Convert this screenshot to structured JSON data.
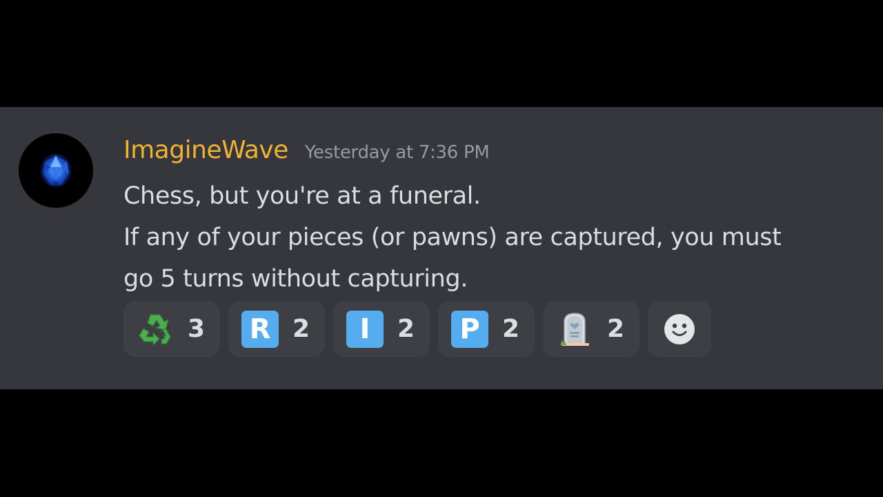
{
  "message": {
    "author": {
      "name": "ImagineWave",
      "name_color": "#f0b232",
      "avatar_icon": "blue-gem-icon"
    },
    "timestamp": "Yesterday at 7:36 PM",
    "timestamp_color": "#949ba4",
    "text_color": "#dbdee1",
    "content_lines": [
      "Chess, but you're at a funeral.",
      "If any of your pieces (or pawns) are captured, you must",
      "go 5 turns without capturing."
    ]
  },
  "reactions": [
    {
      "emoji": "recycle-icon",
      "count": "3"
    },
    {
      "emoji": "regional-indicator-r-icon",
      "letter": "R",
      "tile_color": "#55acee",
      "count": "2"
    },
    {
      "emoji": "regional-indicator-i-icon",
      "letter": "I",
      "tile_color": "#55acee",
      "count": "2"
    },
    {
      "emoji": "regional-indicator-p-icon",
      "letter": "P",
      "tile_color": "#55acee",
      "count": "2"
    },
    {
      "emoji": "headstone-icon",
      "count": "2"
    }
  ],
  "add_reaction": {
    "icon": "add-reaction-smiley-icon"
  },
  "colors": {
    "background": "#000000",
    "panel": "#36373d",
    "reaction_bg": "#3e3f45"
  }
}
